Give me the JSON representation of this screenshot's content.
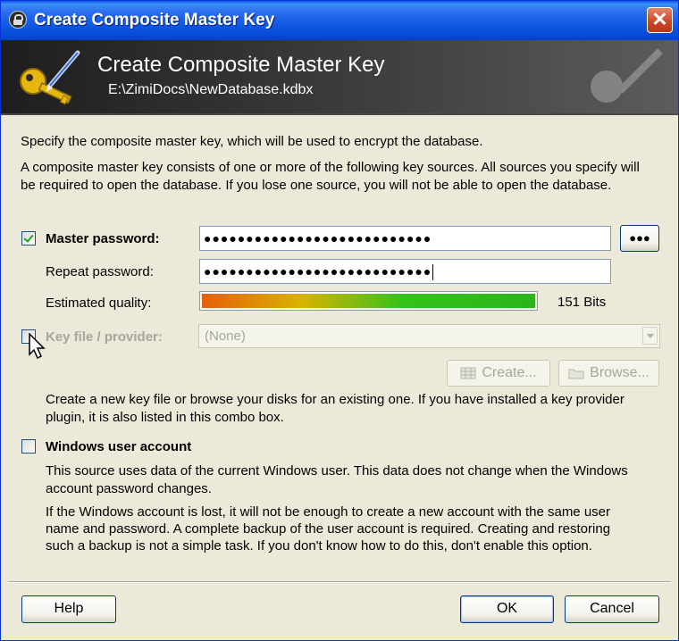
{
  "window": {
    "title": "Create Composite Master Key",
    "close_label": "✕"
  },
  "banner": {
    "title": "Create Composite Master Key",
    "path": "E:\\ZimiDocs\\NewDatabase.kdbx"
  },
  "intro": {
    "line1": "Specify the composite master key, which will be used to encrypt the database.",
    "line2": "A composite master key consists of one or more of the following key sources. All sources you specify will",
    "line3": "be required to open the database.  If you lose one source, you will not be able to open the database."
  },
  "master_password": {
    "label": "Master password:",
    "checked": true,
    "value": "●●●●●●●●●●●●●●●●●●●●●●●●●●●",
    "toggle_label": "●●●"
  },
  "repeat_password": {
    "label": "Repeat password:",
    "value": "●●●●●●●●●●●●●●●●●●●●●●●●●●●"
  },
  "quality": {
    "label": "Estimated quality:",
    "fill_fraction": 1.0,
    "bits_text": "151 Bits"
  },
  "key_file": {
    "label": "Key file / provider:",
    "checked": false,
    "selected": "(None)",
    "create_label": "Create...",
    "browse_label": "Browse...",
    "help_line1": "Create a new key file or browse your disks for an existing one. If you have installed a key provider",
    "help_line2": "plugin, it is also listed in this combo box."
  },
  "windows_account": {
    "label": "Windows user account",
    "checked": false,
    "desc1_line1": "This source uses data of the current Windows user. This data does not change when the Windows",
    "desc1_line2": "account password changes.",
    "desc2_line1": "If the Windows account is lost, it will not be enough to create a new account with the same user",
    "desc2_line2": "name and password. A complete backup of the user account is required. Creating and restoring",
    "desc2_line3": "such a backup is not a simple task. If you don't know how to do this, don't enable this option."
  },
  "buttons": {
    "help": "Help",
    "ok": "OK",
    "cancel": "Cancel"
  },
  "colors": {
    "titlebar": "#0A54E0",
    "dialog_bg": "#ECE9D8",
    "close": "#CC4523",
    "checkmark": "#21A121"
  }
}
